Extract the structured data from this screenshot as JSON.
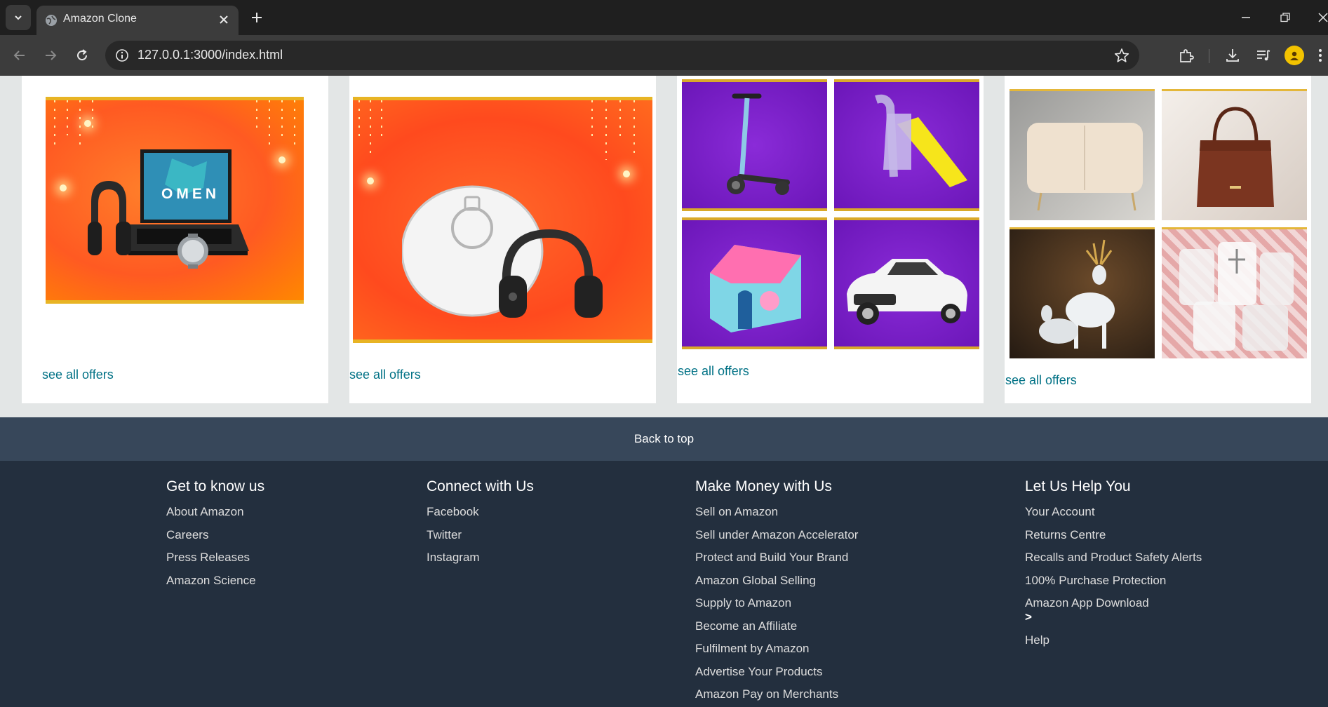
{
  "browser": {
    "tab_title": "Amazon Clone",
    "url": "127.0.0.1:3000/index.html"
  },
  "cards": [
    {
      "product": "OMEN",
      "link": "see all offers"
    },
    {
      "link": "see all offers"
    },
    {
      "link": "see all offers"
    },
    {
      "link": "see all offers"
    }
  ],
  "footer": {
    "back_to_top": "Back to top",
    "columns": [
      {
        "heading": "Get to know us",
        "links": [
          "About Amazon",
          "Careers",
          "Press Releases",
          "Amazon Science"
        ]
      },
      {
        "heading": "Connect with Us",
        "links": [
          "Facebook",
          "Twitter",
          "Instagram"
        ]
      },
      {
        "heading": "Make Money with Us",
        "links": [
          "Sell on Amazon",
          "Sell under Amazon Accelerator",
          "Protect and Build Your Brand",
          "Amazon Global Selling",
          "Supply to Amazon",
          "Become an Affiliate",
          "Fulfilment by Amazon",
          "Advertise Your Products",
          "Amazon Pay on Merchants"
        ]
      },
      {
        "heading": "Let Us Help You",
        "links": [
          "Your Account",
          "Returns Centre",
          "Recalls and Product Safety Alerts",
          "100% Purchase Protection",
          "Amazon App Download",
          "Help"
        ],
        "chevron": ">"
      }
    ]
  },
  "colors": {
    "link": "#007185",
    "footer_bg": "#232f3e",
    "back_to_top_bg": "#37475a",
    "page_bg": "#e3e6e6"
  }
}
